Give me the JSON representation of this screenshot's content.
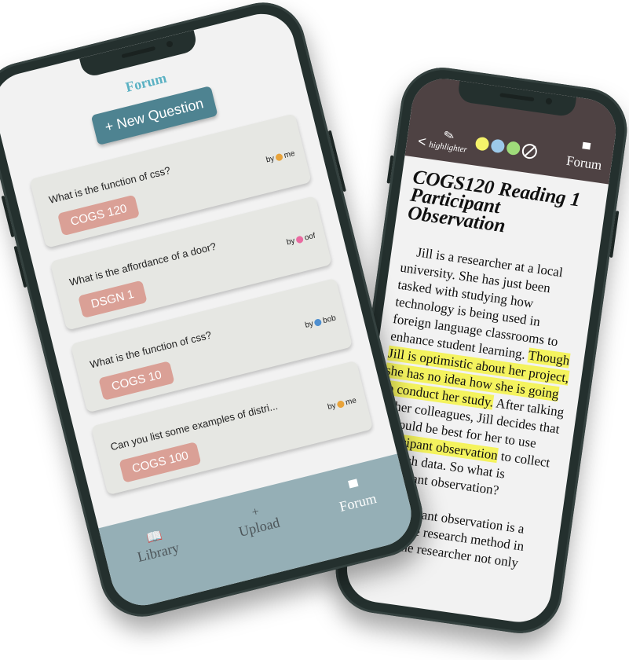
{
  "forum_screen": {
    "title": "Forum",
    "new_question_label": "+ New Question",
    "questions": [
      {
        "text": "What is the function of css?",
        "by": "by",
        "author": "me",
        "emoji_color": "#e8a33a",
        "tag": "COGS 120"
      },
      {
        "text": "What is the affordance of a door?",
        "by": "by",
        "author": "oof",
        "emoji_color": "#e96aa0",
        "tag": "DSGN 1"
      },
      {
        "text": "What is the function of css?",
        "by": "by",
        "author": "bob",
        "emoji_color": "#4f8fcf",
        "tag": "COGS 10"
      },
      {
        "text": "Can you list some examples of distri...",
        "by": "by",
        "author": "me",
        "emoji_color": "#e8a33a",
        "tag": "COGS 100"
      }
    ],
    "nav": [
      {
        "icon": "book-icon",
        "glyph": "📖",
        "label": "Library"
      },
      {
        "icon": "plus-icon",
        "glyph": "+",
        "label": "Upload"
      },
      {
        "icon": "chat-icon",
        "glyph": "▀",
        "label": "Forum"
      }
    ]
  },
  "reader_screen": {
    "back_glyph": "<",
    "highlighter_label": "highlighter",
    "swatches": [
      {
        "name": "yellow",
        "color": "#f5f36a"
      },
      {
        "name": "blue",
        "color": "#9cc9e9"
      },
      {
        "name": "green",
        "color": "#9fdc7a"
      }
    ],
    "forum_label": "Forum",
    "title": "COGS120 Reading 1 Participant Observation",
    "paragraph1": {
      "plain_a": "Jill is a researcher at a local university. She has just been tasked with studying how technology is being used in foreign language classrooms to enhance student learning. ",
      "highlight_a": "Though Jill is optimistic about her project, she has no idea how she is going to conduct her study.",
      "plain_b": " After talking to her colleagues, Jill decides that it would be best for her to use ",
      "highlight_b": "participant observation",
      "plain_c": " to collect research data. So what is participant observation?"
    },
    "paragraph2": "Participant observation is a qualitative research method in which the researcher not only"
  },
  "colors": {
    "forum_accent": "#5ab1c3",
    "new_question_bg": "#4e8391",
    "tag_bg": "#daa096",
    "nav_bg": "#95afb6",
    "reader_header_bg": "#4e4243",
    "highlight": "#f4f35e"
  }
}
